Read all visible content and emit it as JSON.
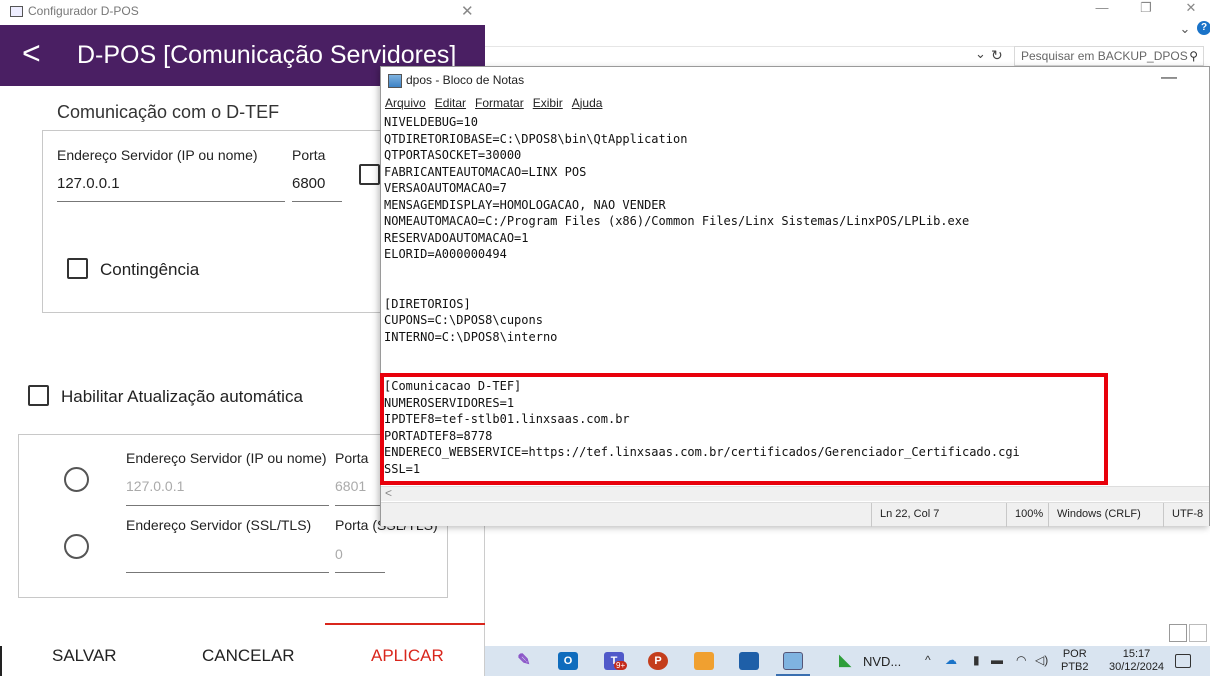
{
  "explorer": {
    "search_placeholder": "Pesquisar em BACKUP_DPOS",
    "controls": {
      "minimize": "—",
      "maximize": "❐",
      "close": "✕",
      "chevron": "⌄",
      "help": "?"
    },
    "refresh": "↻",
    "dropdown": "⌄",
    "search_icon": "⚲"
  },
  "dpos": {
    "window_title": "Configurador D-POS",
    "close": "✕",
    "back": "<",
    "header_title": "D-POS [Comunicação Servidores]",
    "dtef_section": {
      "title": "Comunicação com o D-TEF",
      "server_label": "Endereço Servidor (IP ou nome)",
      "server_value": "127.0.0.1",
      "port_label": "Porta",
      "port_value": "6800",
      "contingency_label": "Contingência"
    },
    "auto_update_label": "Habilitar Atualização automática",
    "update_section": {
      "server_label": "Endereço Servidor (IP ou nome)",
      "server_value": "127.0.0.1",
      "port_label": "Porta",
      "port_value": "6801",
      "ssl_server_label": "Endereço Servidor (SSL/TLS)",
      "ssl_server_value": "",
      "ssl_port_label": "Porta (SSL/TLS)",
      "ssl_port_value": "0"
    },
    "buttons": {
      "save": "SALVAR",
      "cancel": "CANCELAR",
      "apply": "APLICAR"
    }
  },
  "notepad": {
    "title": "dpos - Bloco de Notas",
    "minimize": "—",
    "menu": [
      "Arquivo",
      "Editar",
      "Formatar",
      "Exibir",
      "Ajuda"
    ],
    "lines": [
      "NIVELDEBUG=10",
      "QTDIRETORIOBASE=C:\\DPOS8\\bin\\QtApplication",
      "QTPORTASOCKET=30000",
      "FABRICANTEAUTOMACAO=LINX POS",
      "VERSAOAUTOMACAO=7",
      "MENSAGEMDISPLAY=HOMOLOGACAO, NAO VENDER",
      "NOMEAUTOMACAO=C:/Program Files (x86)/Common Files/Linx Sistemas/LinxPOS/LPLib.exe",
      "RESERVADOAUTOMACAO=1",
      "ELORID=A000000494",
      "",
      "",
      "[DIRETORIOS]",
      "CUPONS=C:\\DPOS8\\cupons",
      "INTERNO=C:\\DPOS8\\interno",
      "",
      "",
      "[Comunicacao D-TEF]",
      "NUMEROSERVIDORES=1",
      "IPDTEF8=tef-stlb01.linxsaas.com.br",
      "PORTADTEF8=8778",
      "ENDERECO_WEBSERVICE=https://tef.linxsaas.com.br/certificados/Gerenciador_Certificado.cgi",
      "SSL=1"
    ],
    "scroll_left": "<",
    "status": {
      "position": "Ln 22, Col 7",
      "zoom": "100%",
      "line_ending": "Windows (CRLF)",
      "encoding": "UTF-8"
    }
  },
  "taskbar": {
    "nvd_label": "NVD...",
    "teams_badge": "9+",
    "language_top": "POR",
    "language_bottom": "PTB2",
    "time": "15:17",
    "date": "30/12/2024",
    "tray": {
      "chevron": "^",
      "onedrive": "☁",
      "usb": "▮",
      "battery": "▬",
      "wifi": "◠",
      "volume": "◁)"
    }
  }
}
